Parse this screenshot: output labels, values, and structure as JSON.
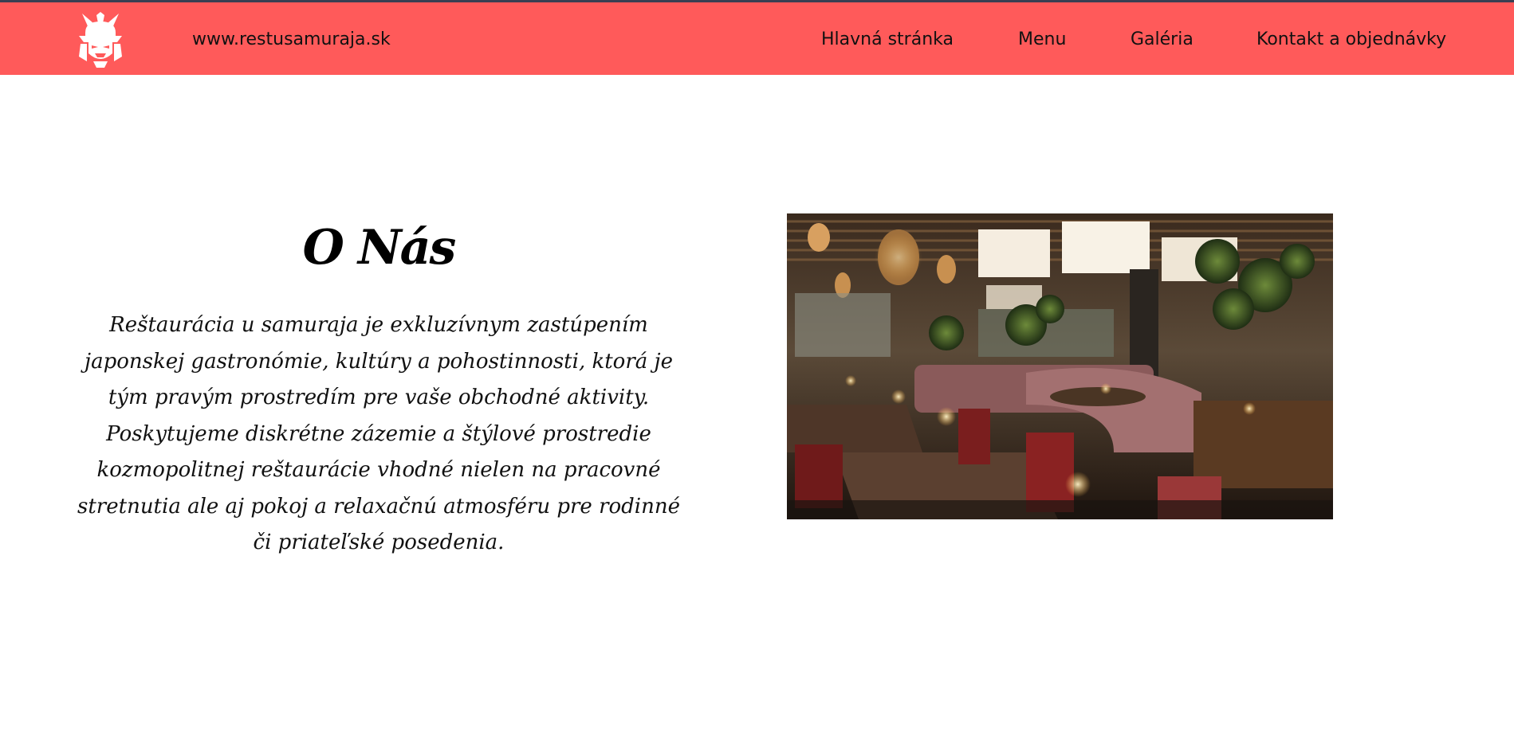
{
  "header": {
    "site_url": "www.restusamuraja.sk",
    "logo_icon": "samurai-helmet-icon",
    "nav": {
      "home": "Hlavná stránka",
      "menu": "Menu",
      "gallery": "Galéria",
      "contact": "Kontakt a objednávky"
    }
  },
  "about": {
    "title": "O Nás",
    "text": "Reštaurácia u samuraja je exkluzívnym zastúpením japonskej gastronómie, kultúry a pohostinnosti, ktorá je tým pravým prostredím pre vaše obchodné aktivity. Poskytujeme diskrétne zázemie a štýlové prostredie kozmopolitnej reštaurácie vhodné nielen na pracovné stretnutia ale aj pokoj a relaxačnú atmosféru pre rodinné či priateľské posedenia."
  },
  "colors": {
    "header_bg": "#ff5a5a",
    "top_line": "#3a3f52",
    "text": "#111111"
  }
}
